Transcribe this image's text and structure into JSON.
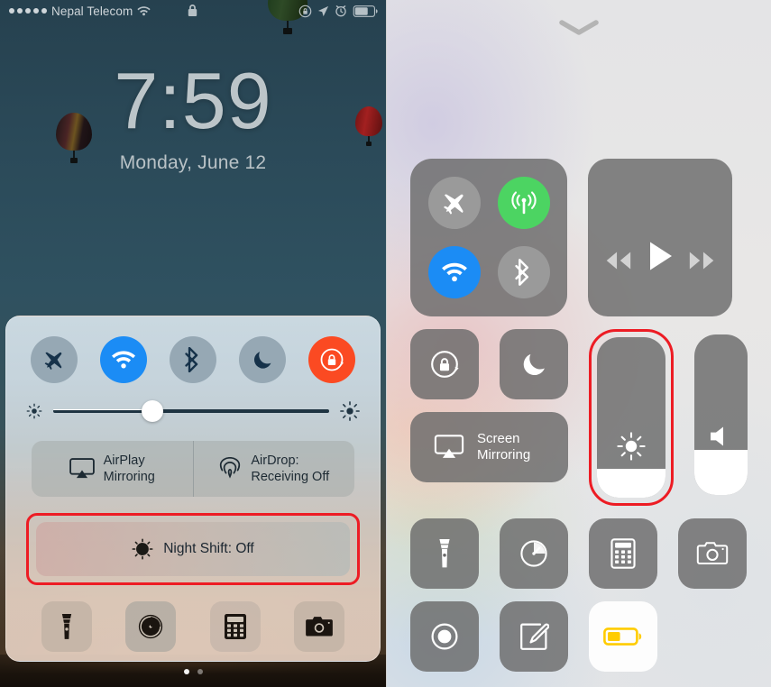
{
  "left_panel": {
    "status_bar": {
      "signal_dots": 5,
      "carrier": "Nepal Telecom",
      "wifi_icon": "wifi-icon",
      "lock_icon": "lock-icon",
      "rotation_lock_icon": "rotation-lock-icon",
      "location_icon": "location-arrow-icon",
      "alarm_icon": "alarm-clock-icon",
      "battery_icon": "battery-icon",
      "battery_level_pct": 62
    },
    "lock_screen": {
      "time": "7:59",
      "date": "Monday, June 12"
    },
    "control_center": {
      "toggles": [
        {
          "name": "airplane-mode",
          "icon": "airplane-icon",
          "state": "off",
          "color": "#96a8b4"
        },
        {
          "name": "wifi",
          "icon": "wifi-icon",
          "state": "on",
          "color": "#1b8cf5"
        },
        {
          "name": "bluetooth",
          "icon": "bluetooth-icon",
          "state": "off",
          "color": "#96a8b4"
        },
        {
          "name": "do-not-disturb",
          "icon": "moon-icon",
          "state": "off",
          "color": "#96a8b4"
        },
        {
          "name": "rotation-lock",
          "icon": "rotation-lock-icon",
          "state": "on",
          "color": "#fb4a22"
        }
      ],
      "brightness": {
        "label_left_icon": "sun-small-icon",
        "label_right_icon": "sun-large-icon",
        "value_pct": 36
      },
      "pill_buttons": [
        {
          "name": "airplay-mirroring",
          "icon": "airplay-icon",
          "line1": "AirPlay",
          "line2": "Mirroring"
        },
        {
          "name": "airdrop",
          "icon": "airdrop-icon",
          "line1": "AirDrop:",
          "line2": "Receiving Off"
        }
      ],
      "night_shift": {
        "icon": "night-shift-icon",
        "label": "Night Shift: Off",
        "highlighted": true,
        "highlight_color": "#ed1c24"
      },
      "app_shortcuts": [
        {
          "name": "flashlight",
          "icon": "flashlight-icon"
        },
        {
          "name": "timer",
          "icon": "timer-icon"
        },
        {
          "name": "calculator",
          "icon": "calculator-icon"
        },
        {
          "name": "camera",
          "icon": "camera-icon"
        }
      ],
      "page_dots": {
        "count": 2,
        "active_index": 0
      }
    }
  },
  "right_panel": {
    "handle_icon": "chevron-down-icon",
    "control_center": {
      "connectivity": [
        {
          "name": "airplane-mode",
          "icon": "airplane-icon",
          "state": "off",
          "color": "#9a9a9a"
        },
        {
          "name": "cellular-data",
          "icon": "cellular-icon",
          "state": "on",
          "color": "#4cd462"
        },
        {
          "name": "wifi",
          "icon": "wifi-icon",
          "state": "on",
          "color": "#1b8cf5"
        },
        {
          "name": "bluetooth",
          "icon": "bluetooth-icon",
          "state": "off",
          "color": "#9a9a9a"
        }
      ],
      "media": {
        "rewind_icon": "rewind-icon",
        "play_icon": "play-icon",
        "forward_icon": "fast-forward-icon"
      },
      "rotation_lock": {
        "name": "rotation-lock",
        "icon": "rotation-lock-icon",
        "state": "off"
      },
      "do_not_disturb": {
        "name": "do-not-disturb",
        "icon": "moon-icon",
        "state": "off"
      },
      "screen_mirroring": {
        "icon": "airplay-icon",
        "line1": "Screen",
        "line2": "Mirroring"
      },
      "brightness_slider": {
        "icon": "sun-icon",
        "value_pct": 18,
        "highlighted": true,
        "highlight_color": "#ed1c24"
      },
      "volume_slider": {
        "icon": "speaker-icon",
        "value_pct": 28,
        "highlighted": false
      },
      "shortcuts_row1": [
        {
          "name": "flashlight",
          "icon": "flashlight-icon",
          "state": "off"
        },
        {
          "name": "timer",
          "icon": "timer-icon",
          "state": "off"
        },
        {
          "name": "calculator",
          "icon": "calculator-icon",
          "state": "off"
        },
        {
          "name": "camera",
          "icon": "camera-icon",
          "state": "off"
        }
      ],
      "shortcuts_row2": [
        {
          "name": "screen-recording",
          "icon": "record-icon",
          "state": "off"
        },
        {
          "name": "notes",
          "icon": "notes-icon",
          "state": "off"
        },
        {
          "name": "low-power-mode",
          "icon": "battery-low-power-icon",
          "state": "on",
          "accent": "#ffcc00"
        }
      ]
    }
  }
}
